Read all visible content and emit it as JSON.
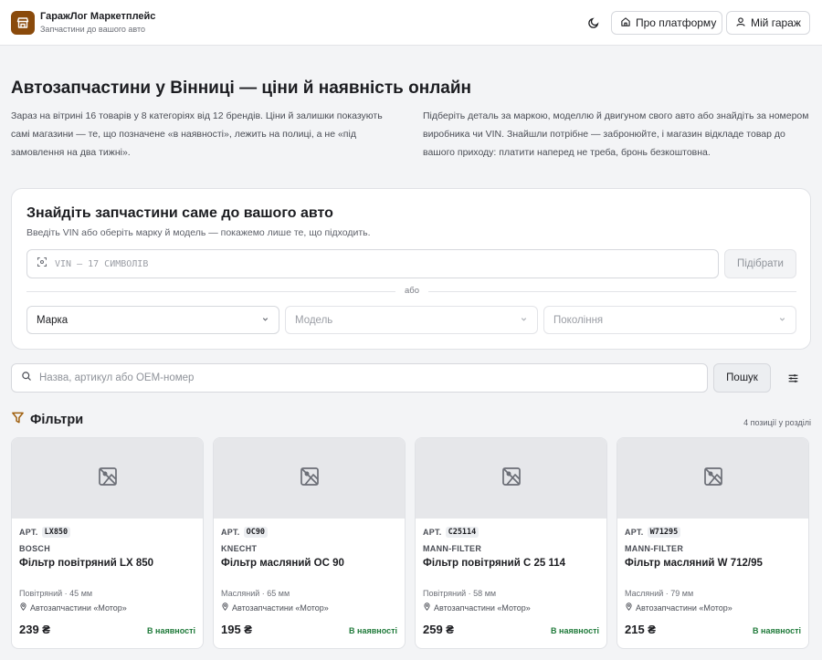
{
  "header": {
    "brand_title": "ГаражЛог Маркетплейс",
    "brand_subtitle": "Запчастини до вашого авто",
    "about_label": "Про платформу",
    "garage_label": "Мій гараж",
    "icons": {
      "logo": "store-icon",
      "theme": "moon-icon",
      "about": "home-icon",
      "garage": "user-icon"
    }
  },
  "hero": {
    "title": "Автозапчастини у Вінниці — ціни й наявність онлайн",
    "intro_left": "Зараз на вітрині 16 товарів у 8 категоріях від 12 брендів. Ціни й залишки показують самі магазини — те, що позначене «в наявності», лежить на полиці, а не «під замовлення на два тижні».",
    "intro_right": "Підберіть деталь за маркою, моделлю й двигуном свого авто або знайдіть за номером виробника чи VIN. Знайшли потрібне — забронюйте, і магазин відкладе товар до вашого приходу: платити наперед не треба, бронь безкоштовна."
  },
  "finder": {
    "title": "Знайдіть запчастини саме до вашого авто",
    "subtitle": "Введіть VIN або оберіть марку й модель — покажемо лише те, що підходить.",
    "vin_placeholder": "VIN — 17 СИМВОЛІВ",
    "pick_button": "Підібрати",
    "or_label": "або",
    "make_select": "Марка",
    "model_select": "Модель",
    "generation_select": "Покоління"
  },
  "search": {
    "placeholder": "Назва, артикул або OEM-номер",
    "button": "Пошук"
  },
  "filters": {
    "label": "Фільтри",
    "count_text": "4 позиції у розділі"
  },
  "products": [
    {
      "art_label": "АРТ.",
      "art_code": "LX850",
      "brand": "BOSCH",
      "name": "Фільтр повітряний LX 850",
      "spec": "Повітряний · 45 мм",
      "shop": "Автозапчастини «Мотор»",
      "price": "239 ₴",
      "stock": "В наявності"
    },
    {
      "art_label": "АРТ.",
      "art_code": "OC90",
      "brand": "KNECHT",
      "name": "Фільтр масляний OC 90",
      "spec": "Масляний · 65 мм",
      "shop": "Автозапчастини «Мотор»",
      "price": "195 ₴",
      "stock": "В наявності"
    },
    {
      "art_label": "АРТ.",
      "art_code": "C25114",
      "brand": "MANN-FILTER",
      "name": "Фільтр повітряний C 25 114",
      "spec": "Повітряний · 58 мм",
      "shop": "Автозапчастини «Мотор»",
      "price": "259 ₴",
      "stock": "В наявності"
    },
    {
      "art_label": "АРТ.",
      "art_code": "W71295",
      "brand": "MANN-FILTER",
      "name": "Фільтр масляний W 712/95",
      "spec": "Масляний · 79 мм",
      "shop": "Автозапчастини «Мотор»",
      "price": "215 ₴",
      "stock": "В наявності"
    }
  ],
  "colors": {
    "accent": "#8a4a0b",
    "in_stock": "#1f7a3a",
    "background": "#f3f4f6"
  }
}
